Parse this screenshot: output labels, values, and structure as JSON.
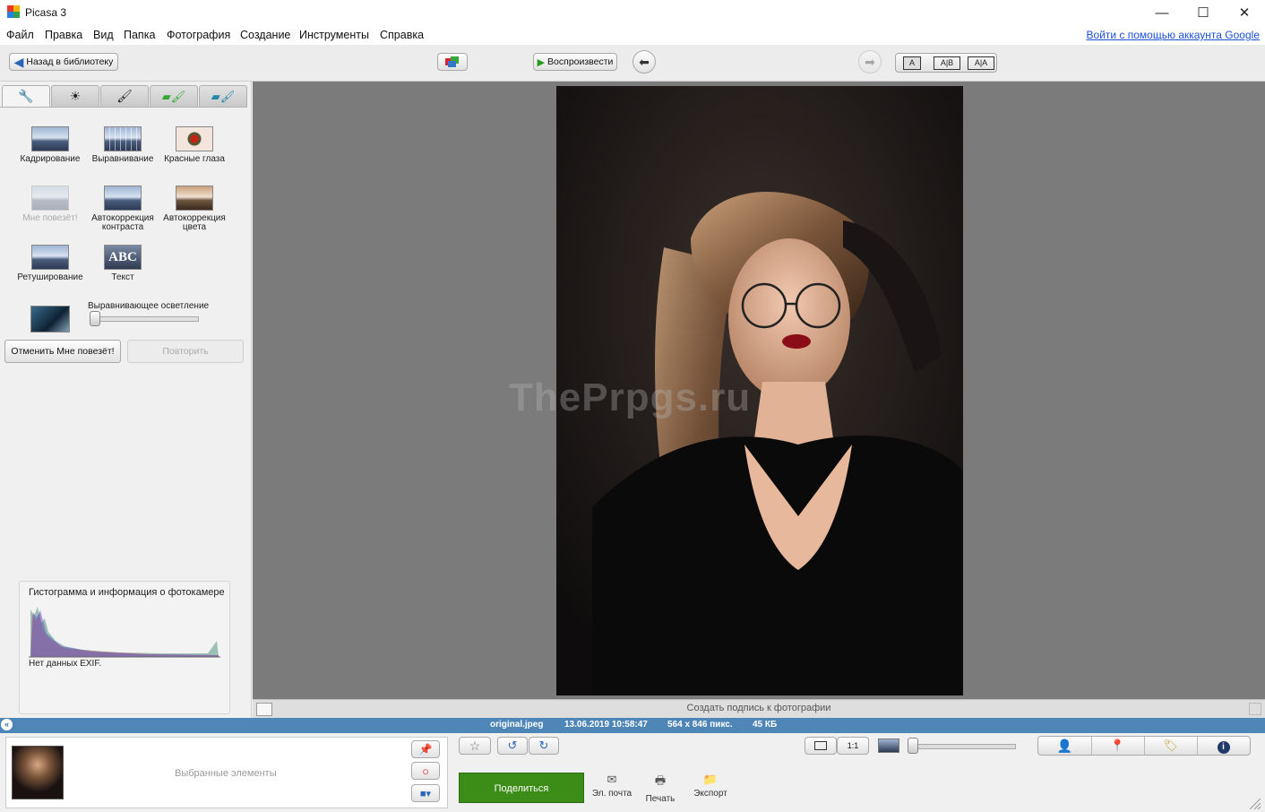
{
  "window": {
    "title": "Picasa 3",
    "minimize_glyph": "—",
    "maximize_glyph": "☐",
    "close_glyph": "✕"
  },
  "menu": [
    "Файл",
    "Правка",
    "Вид",
    "Папка",
    "Фотография",
    "Создание",
    "Инструменты",
    "Справка"
  ],
  "signin_link": "Войти с помощью аккаунта Google",
  "toolbar": {
    "back_label": "Назад в библиотеку",
    "play_label": "Воспроизвести",
    "view_a": "A",
    "view_ab": "A|B",
    "view_aa": "A|A"
  },
  "tools": [
    {
      "label": "Кадрирование",
      "enabled": true
    },
    {
      "label": "Выравнивание",
      "enabled": true
    },
    {
      "label": "Красные глаза",
      "enabled": true
    },
    {
      "label": "Мне повезёт!",
      "enabled": false
    },
    {
      "label": "Автокоррекция контраста",
      "enabled": true
    },
    {
      "label": "Автокоррекция цвета",
      "enabled": true
    },
    {
      "label": "Ретуширование",
      "enabled": true
    },
    {
      "label": "Текст",
      "enabled": true,
      "thumb_text": "ABC"
    }
  ],
  "fill_light": {
    "label": "Выравнивающее осветление",
    "value_fraction": 0.0
  },
  "undo_label": "Отменить Мне повезёт!",
  "redo_label": "Повторить",
  "histogram": {
    "title": "Гистограмма и информация о фотокамере",
    "exif_text": "Нет данных EXIF."
  },
  "watermark": "ThePrpgs.ru",
  "caption_placeholder": "Создать подпись к фотографии",
  "status": {
    "filename": "original.jpeg",
    "datetime": "13.06.2019 10:58:47",
    "dimensions": "564 x 846 пикс.",
    "filesize": "45 КБ"
  },
  "tray": {
    "label": "Выбранные элементы"
  },
  "actions": {
    "share_label": "Поделиться",
    "email_label": "Эл. почта",
    "print_label": "Печать",
    "export_label": "Экспорт",
    "one_to_one": "1:1"
  },
  "colors": {
    "accent_blue": "#4f86b8",
    "share_green": "#3b8d18",
    "link_blue": "#1a4fd6"
  }
}
